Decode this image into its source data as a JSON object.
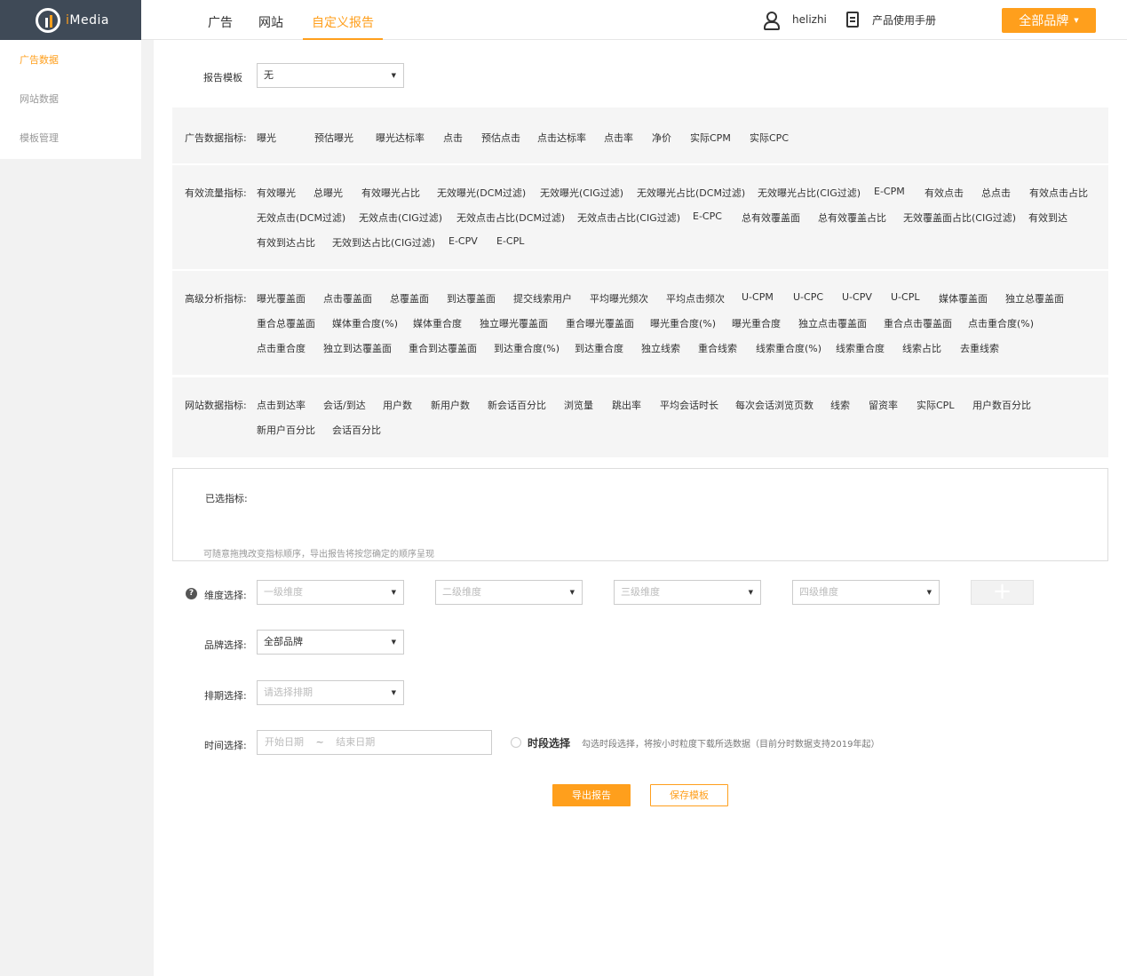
{
  "app": {
    "logo_i": "i",
    "logo_rest": "Media"
  },
  "nav": {
    "tabs": [
      "广告",
      "网站",
      "自定义报告"
    ],
    "active": 2
  },
  "user": {
    "name": "helizhi",
    "manual": "产品使用手册"
  },
  "brand_button": {
    "label": "全部品牌"
  },
  "sidebar": {
    "items": [
      "广告数据",
      "网站数据",
      "模板管理"
    ]
  },
  "report_template": {
    "label": "报告模板",
    "value": "无"
  },
  "metric_groups": [
    {
      "title": "广告数据指标:",
      "rows": [
        [
          "曝光",
          "预估曝光",
          "曝光达标率",
          "点击",
          "预估点击",
          "点击达标率",
          "点击率",
          "净价",
          "实际CPM",
          "实际CPC"
        ]
      ]
    },
    {
      "title": "有效流量指标:",
      "rows": [
        [
          "有效曝光",
          "总曝光",
          "有效曝光占比",
          "无效曝光(DCM过滤)",
          "无效曝光(CIG过滤)",
          "无效曝光占比(DCM过滤)",
          "无效曝光占比(CIG过滤)",
          "E-CPM",
          "有效点击",
          "总点击",
          "有效点击占比"
        ],
        [
          "无效点击(DCM过滤)",
          "无效点击(CIG过滤)",
          "无效点击占比(DCM过滤)",
          "无效点击占比(CIG过滤)",
          "E-CPC",
          "总有效覆盖面",
          "总有效覆盖占比",
          "无效覆盖面占比(CIG过滤)",
          "有效到达"
        ],
        [
          "有效到达占比",
          "无效到达占比(CIG过滤)",
          "E-CPV",
          "E-CPL"
        ]
      ]
    },
    {
      "title": "高级分析指标:",
      "rows": [
        [
          "曝光覆盖面",
          "点击覆盖面",
          "总覆盖面",
          "到达覆盖面",
          "提交线索用户",
          "平均曝光频次",
          "平均点击频次",
          "U-CPM",
          "U-CPC",
          "U-CPV",
          "U-CPL",
          "媒体覆盖面",
          "独立总覆盖面"
        ],
        [
          "重合总覆盖面",
          "媒体重合度(%)",
          "媒体重合度",
          "独立曝光覆盖面",
          "重合曝光覆盖面",
          "曝光重合度(%)",
          "曝光重合度",
          "独立点击覆盖面",
          "重合点击覆盖面",
          "点击重合度(%)"
        ],
        [
          "点击重合度",
          "独立到达覆盖面",
          "重合到达覆盖面",
          "到达重合度(%)",
          "到达重合度",
          "独立线索",
          "重合线索",
          "线索重合度(%)",
          "线索重合度",
          "线索占比",
          "去重线索"
        ]
      ]
    },
    {
      "title": "网站数据指标:",
      "rows": [
        [
          "点击到达率",
          "会话/到达",
          "用户数",
          "新用户数",
          "新会话百分比",
          "浏览量",
          "跳出率",
          "平均会话时长",
          "每次会话浏览页数",
          "线索",
          "留资率",
          "实际CPL",
          "用户数百分比"
        ],
        [
          "新用户百分比",
          "会话百分比"
        ]
      ]
    }
  ],
  "selected": {
    "label": "已选指标:",
    "hint": "可随意拖拽改变指标顺序，导出报告将按您确定的顺序呈现"
  },
  "dimension": {
    "label": "维度选择:",
    "help": "?",
    "placeholders": [
      "一级维度",
      "二级维度",
      "三级维度",
      "四级维度"
    ],
    "add": "+"
  },
  "brand_select": {
    "label": "品牌选择:",
    "value": "全部品牌"
  },
  "schedule_select": {
    "label": "排期选择:",
    "placeholder": "请选择排期"
  },
  "time_select": {
    "label": "时间选择:",
    "start": "开始日期",
    "sep": "~",
    "end": "结束日期",
    "period_label": "时段选择",
    "period_hint": "勾选时段选择，将按小时粒度下载所选数据（目前分时数据支持2019年起）"
  },
  "actions": {
    "export": "导出报告",
    "save": "保存模板"
  },
  "colors": {
    "accent": "#ff9f1c",
    "header_dark": "#3f4a57"
  },
  "icons": [
    "logo-icon",
    "user-icon",
    "document-icon",
    "caret-down-icon",
    "help-icon",
    "plus-icon"
  ]
}
